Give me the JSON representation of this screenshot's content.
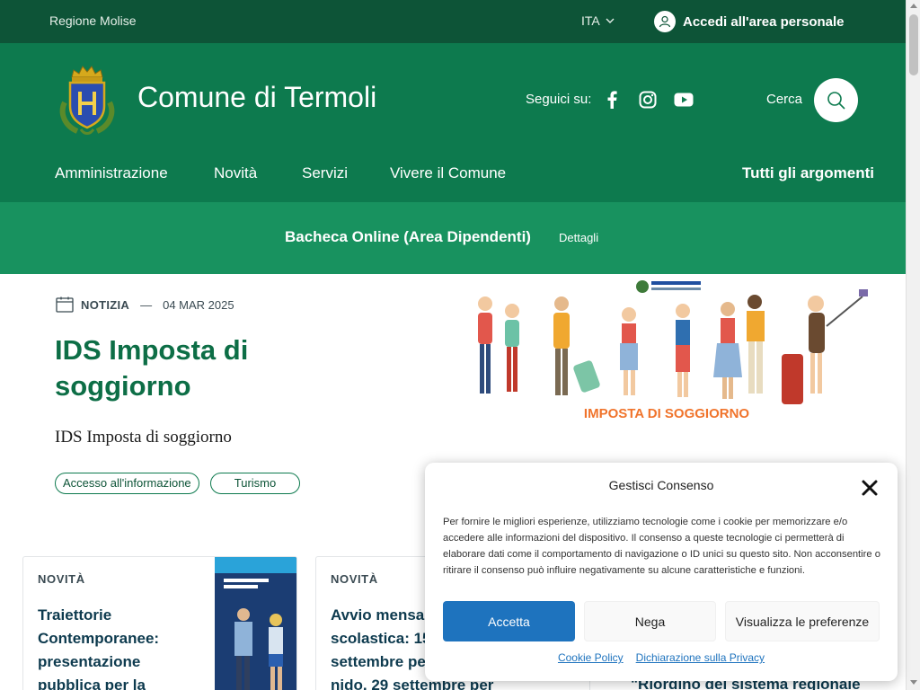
{
  "topbar": {
    "region": "Regione Molise",
    "language": "ITA",
    "login_label": "Accedi all'area personale"
  },
  "header": {
    "site_title": "Comune di Termoli",
    "follow_label": "Seguici su:",
    "search_label": "Cerca",
    "social": [
      "facebook-icon",
      "instagram-icon",
      "youtube-icon"
    ]
  },
  "nav": {
    "items": [
      "Amministrazione",
      "Novità",
      "Servizi",
      "Vivere il Comune"
    ],
    "all_topics": "Tutti gli argomenti"
  },
  "notice": {
    "title": "Bacheca Online (Area Dipendenti)",
    "details": "Dettagli"
  },
  "hero": {
    "kind": "NOTIZIA",
    "date": "04 MAR 2025",
    "title": "IDS Imposta di soggiorno",
    "subtitle": "IDS Imposta di soggiorno",
    "tags": [
      "Accesso all'informazione",
      "Turismo"
    ],
    "image_caption": "IMPOSTA DI SOGGIORNO"
  },
  "cards": [
    {
      "category": "NOVITÀ",
      "title_lines": [
        "Traiettorie",
        "Contemporanee:",
        "presentazione",
        "pubblica per la"
      ]
    },
    {
      "category": "NOVITÀ",
      "title_lines": [
        "Avvio mensa",
        "scolastica: 15",
        "settembre per",
        "nido, 29 settembre per"
      ]
    }
  ],
  "card_right_title": "\"Riordino del sistema regionale",
  "cookie": {
    "title": "Gestisci Consenso",
    "text": "Per fornire le migliori esperienze, utilizziamo tecnologie come i cookie per memorizzare e/o accedere alle informazioni del dispositivo. Il consenso a queste tecnologie ci permetterà di elaborare dati come il comportamento di navigazione o ID unici su questo sito. Non acconsentire o ritirare il consenso può influire negativamente su alcune caratteristiche e funzioni.",
    "accept": "Accetta",
    "deny": "Nega",
    "prefs": "Visualizza le preferenze",
    "link_cookie_policy": "Cookie Policy",
    "link_privacy": "Dichiarazione sulla Privacy"
  },
  "colors": {
    "topbar": "#0d5437",
    "header": "#0d7a4e",
    "notice": "#18925f",
    "accent_title": "#0d6e46",
    "accept_button": "#1e73be"
  }
}
